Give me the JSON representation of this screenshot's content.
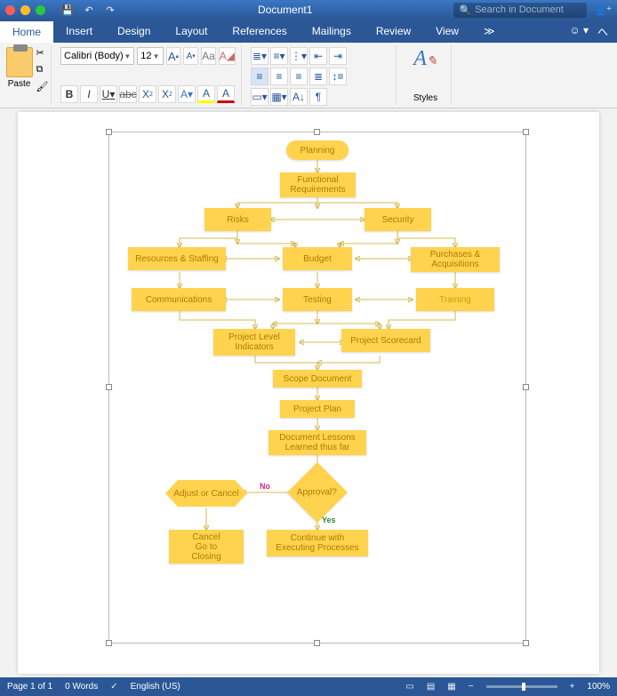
{
  "titlebar": {
    "document_title": "Document1",
    "search_placeholder": "Search in Document"
  },
  "tabs": {
    "home": "Home",
    "insert": "Insert",
    "design": "Design",
    "layout": "Layout",
    "references": "References",
    "mailings": "Mailings",
    "review": "Review",
    "view": "View"
  },
  "ribbon": {
    "paste": "Paste",
    "styles": "Styles",
    "font_name": "Calibri (Body)",
    "font_size": "12",
    "btn_bold": "B",
    "btn_italic": "I",
    "btn_underline": "U",
    "btn_strike": "abc",
    "sub": "X",
    "sup": "X",
    "effects": "A",
    "highlight": "A",
    "color": "A",
    "grow": "A",
    "shrink": "A",
    "clear": "Aa"
  },
  "flow": {
    "planning": "Planning",
    "funcreq": "Functional\nRequirements",
    "risks": "Risks",
    "security": "Security",
    "resources": "Resources & Staffing",
    "budget": "Budget",
    "purchases": "Purchases &\nAcquisitions",
    "comms": "Communications",
    "testing": "Testing",
    "training": "Training",
    "indicators": "Project Level\nIndicators",
    "scorecard": "Project Scorecard",
    "scope": "Scope Document",
    "plan": "Project Plan",
    "lessons": "Document Lessons\nLearned thus far",
    "approval": "Approval?",
    "adjust": "Adjust or Cancel",
    "cancel": "Cancel\nGo to\nClosing",
    "continue": "Continue with\nExecuting Processes",
    "yes": "Yes",
    "no": "No"
  },
  "status": {
    "page": "Page 1 of 1",
    "words": "0 Words",
    "lang": "English (US)",
    "zoom": "100%"
  }
}
